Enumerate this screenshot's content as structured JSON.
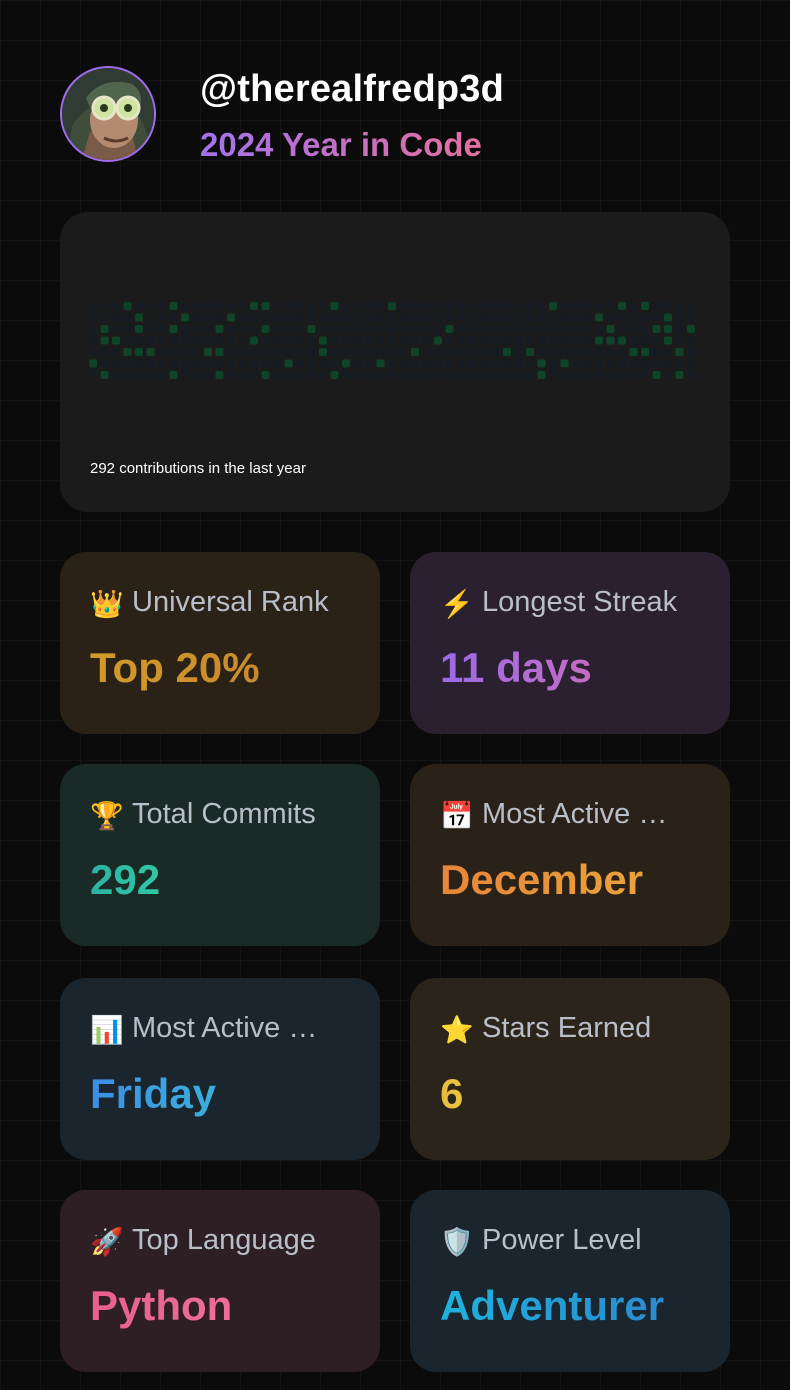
{
  "profile": {
    "username": "@therealfredp3d",
    "subtitle": "2024 Year in Code"
  },
  "contributions": {
    "summary": "292 contributions in the last year",
    "weeks": 53,
    "days_per_week": 7,
    "levels": [
      "0001000100000011000001000010000000000000100000101000000",
      "0000100010001000000000000000000000000000000010000010000",
      "0100100100010001000100000000000100000000000001000110100",
      "0110000000000010000010000000001000000000000011100010010",
      "0001110000110000000010000000100000001010000000011001000",
      "1000000000000000010000100100000000000001010000000000000",
      "0100000100010001000001000000000000000001000000000101000"
    ],
    "colors": [
      "#161b22",
      "#0e4429",
      "#006d32",
      "#26a641",
      "#39d353"
    ]
  },
  "stats": [
    {
      "icon": "crown-icon",
      "emoji": "👑",
      "label": "Universal Rank",
      "value": "Top 20%",
      "bg": "#2a2217",
      "from": "#d39a2a",
      "to": "#c98a2c"
    },
    {
      "icon": "lightning-icon",
      "emoji": "⚡",
      "label": "Longest Streak",
      "value": "11 days",
      "bg": "#2a2030",
      "from": "#9a6be8",
      "to": "#c46cc4"
    },
    {
      "icon": "trophy-icon",
      "emoji": "🏆",
      "label": "Total Commits",
      "value": "292",
      "bg": "#1a2a26",
      "from": "#2bb3a3",
      "to": "#32c7a4"
    },
    {
      "icon": "calendar-icon",
      "emoji": "📅",
      "label": "Most Active …",
      "value": "December",
      "bg": "#2a2219",
      "from": "#e8853a",
      "to": "#e9a33b"
    },
    {
      "icon": "bar-chart-icon",
      "emoji": "📊",
      "label": "Most Active …",
      "value": "Friday",
      "bg": "#1a252d",
      "from": "#3b8fe6",
      "to": "#3ab0dc"
    },
    {
      "icon": "star-icon",
      "emoji": "⭐",
      "label": "Stars Earned",
      "value": "6",
      "bg": "#2b241a",
      "from": "#e9b93d",
      "to": "#ebc63f"
    },
    {
      "icon": "rocket-icon",
      "emoji": "🚀",
      "label": "Top Language",
      "value": "Python",
      "bg": "#2d1f24",
      "from": "#e95f8f",
      "to": "#ec6f97"
    },
    {
      "icon": "shield-icon",
      "emoji": "🛡️",
      "label": "Power Level",
      "value": "Adventurer",
      "bg": "#1a252d",
      "from": "#1fb2dc",
      "to": "#2b8ad0"
    }
  ]
}
